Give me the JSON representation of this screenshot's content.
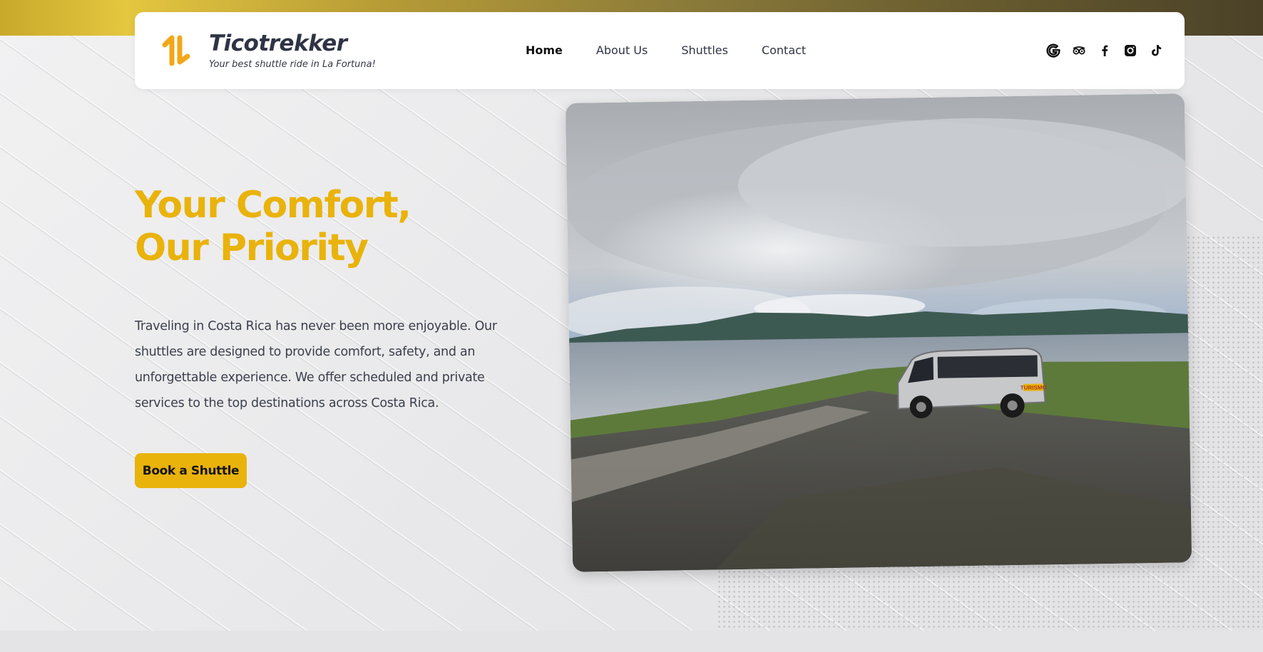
{
  "brand": {
    "name": "Ticotrekker",
    "tagline": "Your best shuttle ride in La Fortuna!",
    "color": "#e9b30c"
  },
  "nav": {
    "items": [
      {
        "label": "Home",
        "active": true
      },
      {
        "label": "About Us",
        "active": false
      },
      {
        "label": "Shuttles",
        "active": false
      },
      {
        "label": "Contact",
        "active": false
      }
    ]
  },
  "socials": [
    "google-icon",
    "tripadvisor-icon",
    "facebook-icon",
    "instagram-icon",
    "tiktok-icon"
  ],
  "hero": {
    "title": "Your Comfort, Our Priority",
    "body": "Traveling in Costa Rica has never been more enjoyable. Our shuttles are designed to provide comfort, safety, and an unforgettable experience. We offer scheduled and private services to the top destinations across Costa Rica.",
    "cta_label": "Book a Shuttle"
  },
  "photo": {
    "van_sign": "TURISMO"
  }
}
